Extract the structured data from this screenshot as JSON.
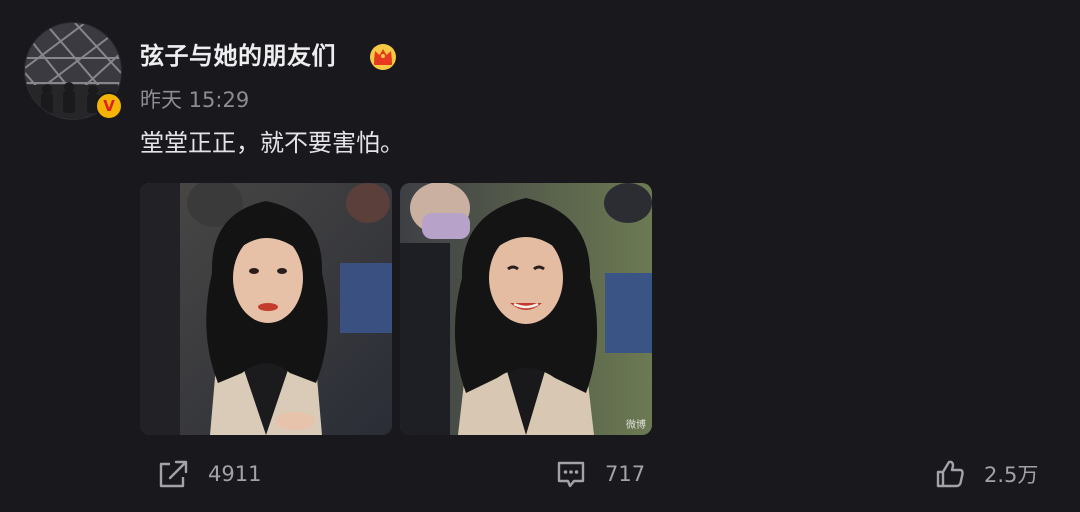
{
  "post": {
    "username": "弦子与她的朋友们",
    "timestamp": "昨天 15:29",
    "text": "堂堂正正，就不要害怕。",
    "photo_watermark": "微博"
  },
  "badges": {
    "verified_letter": "V",
    "verified_color": "#f4b400",
    "crown_icon": "crown-membership-icon"
  },
  "actions": {
    "repost_count": "4911",
    "comment_count": "717",
    "like_count": "2.5万"
  },
  "colors": {
    "background": "#19181d",
    "text_primary": "#eeeef0",
    "text_secondary": "#8c8c93",
    "action_gray": "#a2a2a8"
  }
}
